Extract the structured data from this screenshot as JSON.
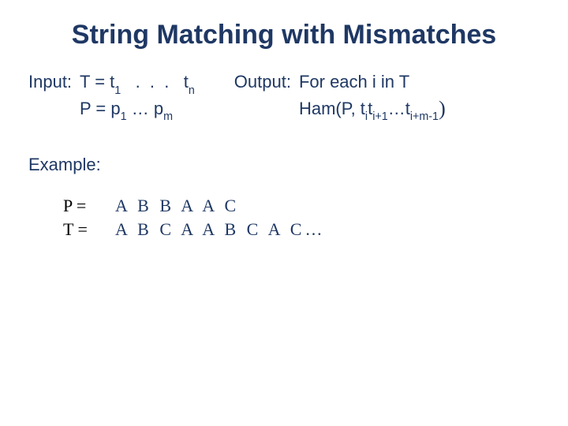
{
  "title": "String Matching with Mismatches",
  "input": {
    "label": "Input:",
    "line1_lhs": "T = ",
    "line1_t1": "t",
    "line1_sub1": "1",
    "line1_dots": "   .  .  .   ",
    "line1_tn": "t",
    "line1_subn": "n",
    "line2_lhs": "P = ",
    "line2_p1": "p",
    "line2_sub1": "1",
    "line2_dots": " … ",
    "line2_pm": "p",
    "line2_subm": "m"
  },
  "output": {
    "label": "Output:",
    "line1": "For each i in T",
    "ham_pre": "Ham(P, ",
    "ti": "t",
    "ti_sub": "i",
    "ti1": "t",
    "ti1_sub": "i+1",
    "hdots": "…",
    "tim": "t",
    "tim_sub": "i+m-1"
  },
  "example": {
    "label": "Example:",
    "p_label": "P =",
    "p_value": "A B B A A C",
    "t_label": "T =",
    "t_value": "A B C A A B C A C"
  }
}
